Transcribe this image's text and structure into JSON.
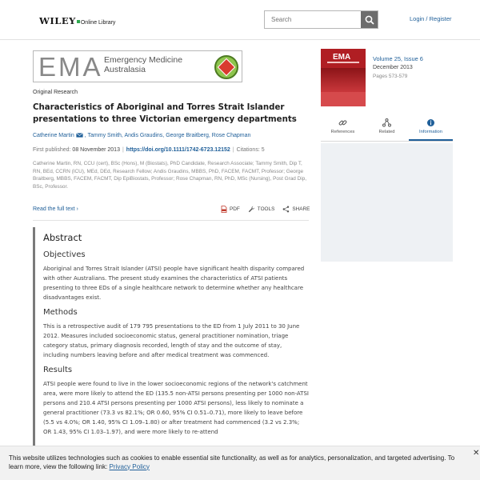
{
  "header": {
    "logo_wiley": "WILEY",
    "logo_online_library": "Online Library",
    "search_placeholder": "Search",
    "login_label": "Login / Register"
  },
  "journal_banner": {
    "abbr": "EMA",
    "line1": "Emergency Medicine",
    "line2": "Australasia"
  },
  "article": {
    "type": "Original Research",
    "title": "Characteristics of Aboriginal and Torres Strait Islander presentations to three Victorian emergency departments",
    "authors": [
      "Catherine Martin",
      "Tammy Smith",
      "Andis Graudins",
      "George Braitberg",
      "Rose Chapman"
    ],
    "first_published_label": "First published:",
    "first_published": "08 November 2013",
    "doi": "https://doi.org/10.1111/1742-6723.12152",
    "citations": "Citations: 5",
    "affiliations": "Catherine Martin, RN, CCU (cert), BSc (Hons), M (Biostats), PhD Candidate, Research Associate; Tammy Smith, Dip T, RN, BEd, CCRN (ICU), MEd, DEd, Research Fellow; Andis Graudins, MBBS, PhD, FACEM, FACMT, Professor; George Braitberg, MBBS, FACEM, FACMT, Dip EpiBiostats, Professor; Rose Chapman, RN, PhD, MSc (Nursing), Post Grad Dip, BSc, Professor.",
    "read_full_text": "Read the full text",
    "actions": {
      "pdf": "PDF",
      "tools": "TOOLS",
      "share": "SHARE"
    }
  },
  "abstract": {
    "heading": "Abstract",
    "sections": [
      {
        "heading": "Objectives",
        "text": "Aboriginal and Torres Strait Islander (ATSI) people have significant health disparity compared with other Australians. The present study examines the characteristics of ATSI patients presenting to three EDs of a single healthcare network to determine whether any healthcare disadvantages exist."
      },
      {
        "heading": "Methods",
        "text": "This is a retrospective audit of 179 795 presentations to the ED from 1 July 2011 to 30 June 2012. Measures included socioeconomic status, general practitioner nomination, triage category status, primary diagnosis recorded, length of stay and the outcome of stay, including numbers leaving before and after medical treatment was commenced."
      },
      {
        "heading": "Results",
        "text": "ATSI people were found to live in the lower socioeconomic regions of the network's catchment area, were more likely to attend the ED (135.5 non-ATSI persons presenting per 1000 non-ATSI persons and 210.4 ATSI persons presenting per 1000 ATSI persons), less likely to nominate a general practitioner (73.3 vs 82.1%; OR 0.60, 95% CI 0.51–0.71), more likely to leave before (5.5 vs 4.0%; OR 1.40, 95% CI 1.09–1.80) or after treatment had commenced (3.2 vs 2.3%; OR 1.43, 95% CI 1.03–1.97), and were more likely to re-attend"
      }
    ]
  },
  "sidebar": {
    "cover_title": "EMA",
    "volume": "Volume 25, Issue 6",
    "date": "December 2013",
    "pages": "Pages 573-579",
    "tabs": [
      {
        "label": "References",
        "icon": "link-icon"
      },
      {
        "label": "Related",
        "icon": "network-icon"
      },
      {
        "label": "Information",
        "icon": "info-icon"
      }
    ],
    "active_tab": "Information"
  },
  "cookie": {
    "text": "This website utilizes technologies such as cookies to enable essential site functionality, as well as for analytics, personalization, and targeted advertising. To learn more, view the following link: ",
    "link_text": "Privacy Policy",
    "close": "✕"
  }
}
